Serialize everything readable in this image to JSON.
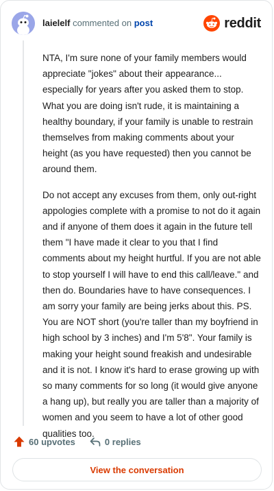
{
  "header": {
    "username": "laielelf",
    "verb": "commented on",
    "target": "post",
    "brand": "reddit"
  },
  "comment": {
    "paragraphs": [
      "NTA, I'm sure none of your family members would appreciate \"jokes\" about their appearance... especially for years after you asked them to stop. What you are doing isn't rude, it is maintaining a healthy boundary, if your family is unable to restrain themselves from making comments about your height (as you have requested) then you cannot be around them.",
      "Do not accept any excuses from them, only out-right appologies complete with a promise to not do it again and if anyone of them does it again in the future tell them \"I have made it clear to you that I find comments about my height hurtful. If you are not able to stop yourself I will have to end this call/leave.\" and then do. Boundaries have to have consequences. I am sorry your family are being jerks about this. PS. You are NOT short (you're taller than my boyfriend in high school by 3 inches) and I'm 5'8\". Your family is making your height sound freakish and undesirable and it is not. I know it's hard to erase growing up with so many comments for so long (it would give anyone a hang up), but really you are taller than a majority of women and you seem to have a lot of other good qualities too."
    ]
  },
  "actions": {
    "upvotes": "60 upvotes",
    "replies": "0 replies"
  },
  "cta": {
    "label": "View the conversation"
  },
  "colors": {
    "brand_orange": "#ff4500",
    "upvote": "#d93a00",
    "link_blue": "#0045ac"
  }
}
